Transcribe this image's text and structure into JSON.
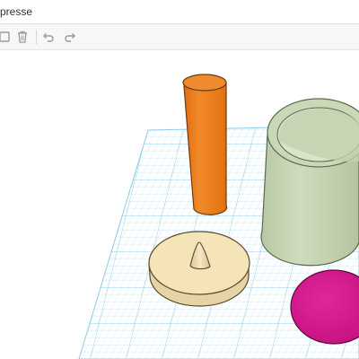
{
  "app": {
    "document_title": "presse"
  },
  "toolbar": {
    "tools": [
      {
        "name": "copy-icon",
        "enabled": true
      },
      {
        "name": "trash-icon",
        "enabled": true
      },
      {
        "name": "undo-icon",
        "enabled": true
      },
      {
        "name": "redo-icon",
        "enabled": true
      }
    ]
  },
  "workplane": {
    "grid_color": "#a8d8f0",
    "background": "#ffffff"
  },
  "shapes": [
    {
      "name": "orange-cylinder",
      "color": "#ef7b1d"
    },
    {
      "name": "green-tube",
      "color": "#c9d8b6"
    },
    {
      "name": "cream-disc",
      "color": "#f4e4b8"
    },
    {
      "name": "cone",
      "color": "#f4e4b8"
    },
    {
      "name": "magenta-disc",
      "color": "#d4188b"
    }
  ]
}
